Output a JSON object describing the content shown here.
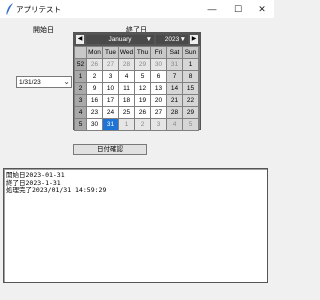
{
  "window": {
    "title": "アプリテスト",
    "controls": {
      "minimize": "—",
      "maximize": "☐",
      "close": "✕"
    }
  },
  "labels": {
    "start": "開始日",
    "end": "終了日"
  },
  "start_picker": {
    "value": "1/31/23",
    "dropdown_icon": "chevron-down-icon"
  },
  "calendar": {
    "prev_icon": "◀",
    "next_icon": "▶",
    "month": "January",
    "year": "2023",
    "caret": "▼",
    "weekday_headers": [
      "Mon",
      "Tue",
      "Wed",
      "Thu",
      "Fri",
      "Sat",
      "Sun"
    ],
    "weeks": [
      {
        "num": "52",
        "days": [
          "26",
          "27",
          "28",
          "29",
          "30",
          "31",
          "1"
        ]
      },
      {
        "num": "1",
        "days": [
          "2",
          "3",
          "4",
          "5",
          "6",
          "7",
          "8"
        ]
      },
      {
        "num": "2",
        "days": [
          "9",
          "10",
          "11",
          "12",
          "13",
          "14",
          "15"
        ]
      },
      {
        "num": "3",
        "days": [
          "16",
          "17",
          "18",
          "19",
          "20",
          "21",
          "22"
        ]
      },
      {
        "num": "4",
        "days": [
          "23",
          "24",
          "25",
          "26",
          "27",
          "28",
          "29"
        ]
      },
      {
        "num": "5",
        "days": [
          "30",
          "31",
          "1",
          "2",
          "3",
          "4",
          "5"
        ]
      }
    ],
    "selected": "31",
    "colors": {
      "selected": "#1e73d6",
      "header": "#555555"
    }
  },
  "check_button": {
    "label": "日付確認"
  },
  "output": {
    "lines": [
      "開始日2023-01-31",
      "終了日2023-1-31",
      "処理完了2023/01/31 14:59:29"
    ]
  }
}
